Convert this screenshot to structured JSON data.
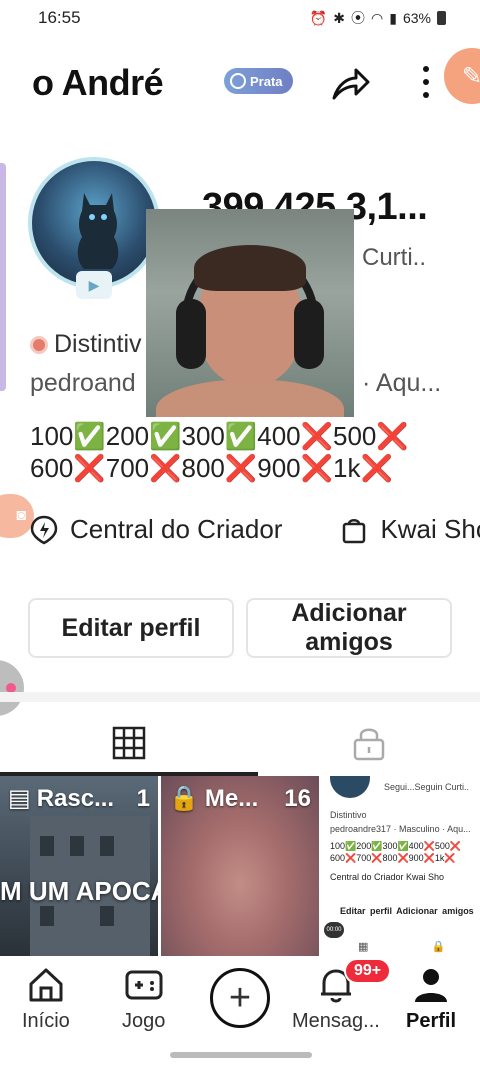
{
  "status_bar": {
    "time": "16:55",
    "battery": "63%"
  },
  "header": {
    "username": "o André",
    "tier_badge": "Prata"
  },
  "profile": {
    "stats_numbers": [
      "399",
      "425",
      "3,1..."
    ],
    "stat_label": "Curti..",
    "badge_text": "Distintiv",
    "info_text": "pedroand",
    "info_tail": "· Aqu...",
    "bio": "100✅200✅300✅400❌500❌\n600❌700❌800❌900❌1k❌"
  },
  "links": {
    "creator_center": "Central do Criador",
    "kwai_shop": "Kwai Sho"
  },
  "actions": {
    "edit_profile": "Editar perfil",
    "add_friends": "Adicionar amigos"
  },
  "grid": {
    "items": [
      {
        "label": "Rasc...",
        "count": "1",
        "caption": "M UM APOCA"
      },
      {
        "label": "Me...",
        "count": "16"
      }
    ],
    "mini_preview": {
      "stats": "Segui...Seguin Curti..",
      "badge": "Distintivo",
      "info": "pedroandre317 · Masculino · Aqu...",
      "bio": "100✅200✅300✅400❌500❌\n600❌700❌800❌900❌1k❌",
      "links": "Central do Criador    Kwai Sho",
      "buttons": "Editar perfil  Adicionar amigos",
      "time": "00:00"
    }
  },
  "bottom_nav": {
    "home": "Início",
    "game": "Jogo",
    "messages": "Mensag...",
    "profile": "Perfil",
    "notification_count": "99+"
  },
  "colors": {
    "accent_orange": "#f4a37e",
    "badge_red": "#ef2a3a",
    "tier_blue": "#7da0d8"
  }
}
